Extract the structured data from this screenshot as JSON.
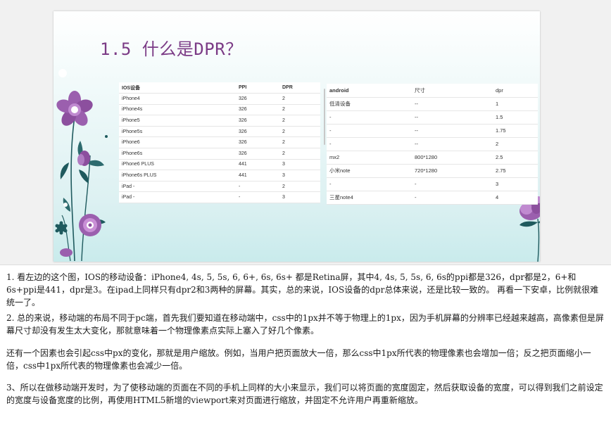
{
  "slide": {
    "title": "1.5 什么是DPR？",
    "ios_table": {
      "headers": [
        "IOS设备",
        "PPI",
        "DPR"
      ],
      "rows": [
        [
          "iPhone4",
          "326",
          "2"
        ],
        [
          "iPhone4s",
          "326",
          "2"
        ],
        [
          "iPhone5",
          "326",
          "2"
        ],
        [
          "iPhone5s",
          "326",
          "2"
        ],
        [
          "iPhone6",
          "326",
          "2"
        ],
        [
          "iPhone6s",
          "326",
          "2"
        ],
        [
          "iPhone6 PLUS",
          "441",
          "3"
        ],
        [
          "iPhone6s PLUS",
          "441",
          "3"
        ],
        [
          "iPad -",
          "-",
          "2"
        ],
        [
          "iPad -",
          "-",
          "3"
        ]
      ]
    },
    "android_table": {
      "headers": [
        "android",
        "尺寸",
        "dpr"
      ],
      "rows": [
        [
          "低清设备",
          "--",
          "1"
        ],
        [
          "-",
          "--",
          "1.5"
        ],
        [
          "-",
          "--",
          "1.75"
        ],
        [
          "-",
          "--",
          "2"
        ],
        [
          "mx2",
          "800*1280",
          "2.5"
        ],
        [
          "小米note",
          "720*1280",
          "2.75"
        ],
        [
          "-",
          "-",
          "3"
        ],
        [
          "三星note4",
          "-",
          "4"
        ]
      ]
    },
    "colors": {
      "title": "#7b3b86",
      "flower": "#8c4f9e",
      "leaf": "#1f5a5e"
    }
  },
  "notes": {
    "p1": "1.  看左边的这个图，IOS的移动设备：iPhone4, 4s, 5, 5s, 6, 6+, 6s, 6s+ 都是Retina屏，其中4, 4s, 5, 5s, 6, 6s的ppi都是326，dpr都是2，6+和6s+ppi是441，dpr是3。在ipad上同样只有dpr2和3两种的屏幕。其实，总的来说，IOS设备的dpr总体来说，还是比较一致的。      再看一下安卓，比例就很难统一了。",
    "p2": "2. 总的来说，移动端的布局不同于pc端，首先我们要知道在移动端中，css中的1px并不等于物理上的1px，因为手机屏幕的分辨率已经越来越高，高像素但是屏幕尺寸却没有发生太大变化，那就意味着一个物理像素点实际上塞入了好几个像素。",
    "p3": "还有一个因素也会引起css中px的变化，那就是用户缩放。例如，当用户把页面放大一倍，那么css中1px所代表的物理像素也会增加一倍；反之把页面缩小一倍，css中1px所代表的物理像素也会减少一倍。",
    "p4": "3、所以在做移动端开发时，为了使移动端的页面在不同的手机上同样的大小来显示，我们可以将页面的宽度固定，然后获取设备的宽度，可以得到我们之前设定的宽度与设备宽度的比例，再使用HTML5新增的viewport来对页面进行缩放，并固定不允许用户再重新缩放。"
  }
}
